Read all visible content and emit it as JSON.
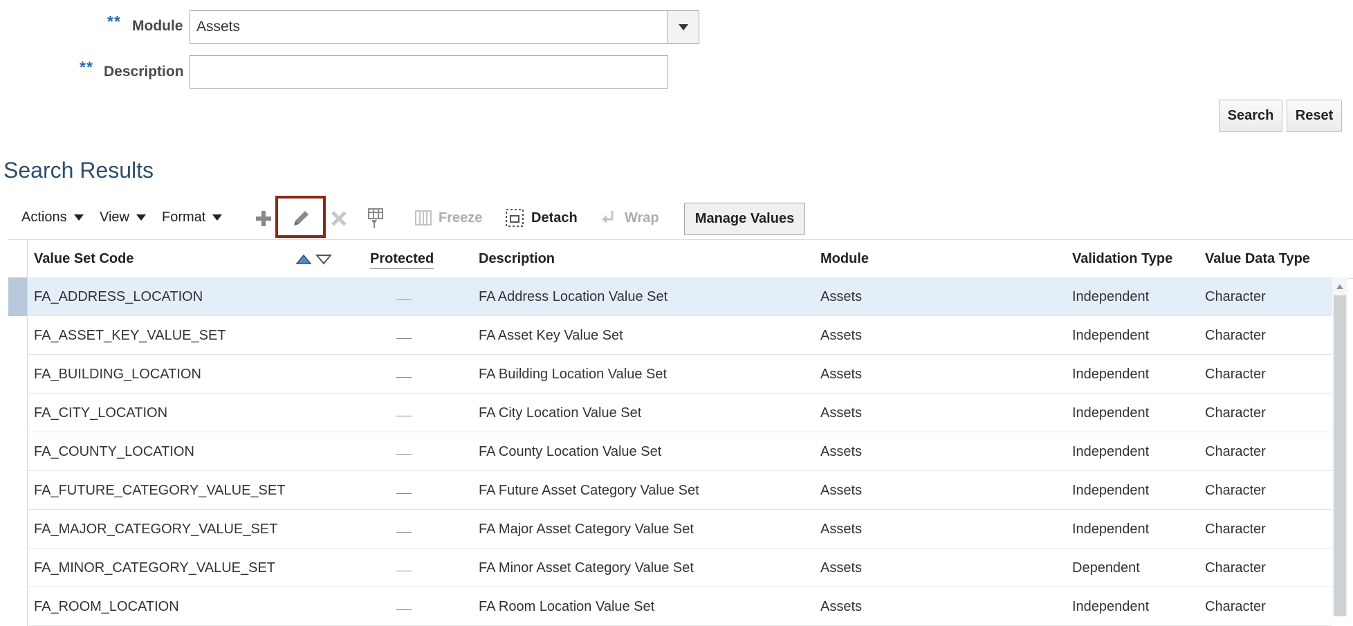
{
  "form": {
    "required_marker": "**",
    "module_label": "Module",
    "module_value": "Assets",
    "description_label": "Description",
    "description_value": "",
    "search_label": "Search",
    "reset_label": "Reset"
  },
  "results": {
    "title": "Search Results",
    "toolbar": {
      "actions_label": "Actions",
      "view_label": "View",
      "format_label": "Format",
      "freeze_label": "Freeze",
      "detach_label": "Detach",
      "wrap_label": "Wrap",
      "manage_values_label": "Manage Values"
    },
    "columns": {
      "code": "Value Set Code",
      "protected": "Protected",
      "description": "Description",
      "module": "Module",
      "validation": "Validation Type",
      "datatype": "Value Data Type"
    },
    "rows": [
      {
        "code": "FA_ADDRESS_LOCATION",
        "description": "FA Address Location Value Set",
        "module": "Assets",
        "validation": "Independent",
        "datatype": "Character"
      },
      {
        "code": "FA_ASSET_KEY_VALUE_SET",
        "description": "FA Asset Key Value Set",
        "module": "Assets",
        "validation": "Independent",
        "datatype": "Character"
      },
      {
        "code": "FA_BUILDING_LOCATION",
        "description": "FA Building Location Value Set",
        "module": "Assets",
        "validation": "Independent",
        "datatype": "Character"
      },
      {
        "code": "FA_CITY_LOCATION",
        "description": "FA City Location Value Set",
        "module": "Assets",
        "validation": "Independent",
        "datatype": "Character"
      },
      {
        "code": "FA_COUNTY_LOCATION",
        "description": "FA County Location Value Set",
        "module": "Assets",
        "validation": "Independent",
        "datatype": "Character"
      },
      {
        "code": "FA_FUTURE_CATEGORY_VALUE_SET",
        "description": "FA Future Asset Category Value Set",
        "module": "Assets",
        "validation": "Independent",
        "datatype": "Character"
      },
      {
        "code": "FA_MAJOR_CATEGORY_VALUE_SET",
        "description": "FA Major Asset Category Value Set",
        "module": "Assets",
        "validation": "Independent",
        "datatype": "Character"
      },
      {
        "code": "FA_MINOR_CATEGORY_VALUE_SET",
        "description": "FA Minor Asset Category Value Set",
        "module": "Assets",
        "validation": "Dependent",
        "datatype": "Character"
      },
      {
        "code": "FA_ROOM_LOCATION",
        "description": "FA Room Location Value Set",
        "module": "Assets",
        "validation": "Independent",
        "datatype": "Character"
      }
    ]
  },
  "icons": {
    "add": "plus-icon",
    "edit": "pencil-icon",
    "delete": "x-icon",
    "query": "query-by-example-icon",
    "freeze": "freeze-icon",
    "detach": "detach-icon",
    "wrap": "wrap-icon",
    "sort_asc": "sort-ascending-icon",
    "sort_desc": "sort-descending-icon"
  },
  "colors": {
    "selected_row": "#e4eef8",
    "highlight_border": "#8c2a14",
    "required_marker": "#1f6bb3",
    "section_title": "#2e4e6e"
  }
}
